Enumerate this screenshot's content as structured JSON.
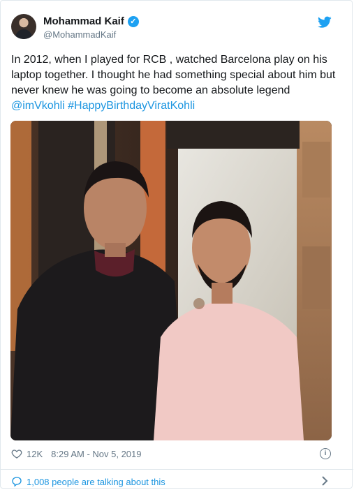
{
  "author": {
    "display_name": "Mohammad Kaif",
    "handle": "@MohammadKaif",
    "verified": true
  },
  "tweet": {
    "text": "In 2012, when I played for RCB , watched Barcelona play on his laptop together. I thought he had something special about him but never knew he was going to become an absolute legend",
    "tags": "@imVkohli #HappyBirthdayViratKohli",
    "likes": "12K",
    "timestamp": "8:29 AM - Nov 5, 2019"
  },
  "footer": {
    "talking": "1,008 people are talking about this"
  },
  "icons": {
    "brand": "twitter-bird-icon",
    "verified": "verified-badge-icon",
    "like": "heart-icon",
    "info": "info-icon",
    "conversation": "speech-bubble-icon",
    "chevron": "chevron-right-icon"
  },
  "colors": {
    "brand_blue": "#1da1f2",
    "link_blue": "#1b95e0",
    "muted_text": "#657786",
    "border": "#e1e8ed"
  }
}
